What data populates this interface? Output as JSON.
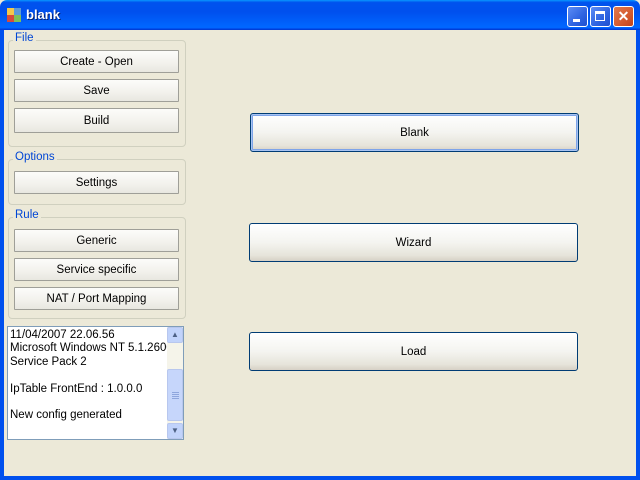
{
  "window": {
    "title": "blank",
    "icon": "app-window-icon"
  },
  "sidebar": {
    "file": {
      "label": "File",
      "buttons": [
        "Create - Open",
        "Save",
        "Build"
      ]
    },
    "options": {
      "label": "Options",
      "buttons": [
        "Settings"
      ]
    },
    "rule": {
      "label": "Rule",
      "buttons": [
        "Generic",
        "Service specific",
        "NAT / Port Mapping"
      ]
    }
  },
  "log": {
    "lines": [
      "11/04/2007 22.06.56",
      "Microsoft Windows NT 5.1.2600",
      "Service Pack 2",
      "",
      "IpTable FrontEnd : 1.0.0.0",
      "",
      "New config generated"
    ]
  },
  "main": {
    "buttons": [
      "Blank",
      "Wizard",
      "Load"
    ]
  },
  "colors": {
    "title_bar": "#0050ee",
    "group_label": "#0046d5",
    "window_background": "#ece9d8"
  }
}
